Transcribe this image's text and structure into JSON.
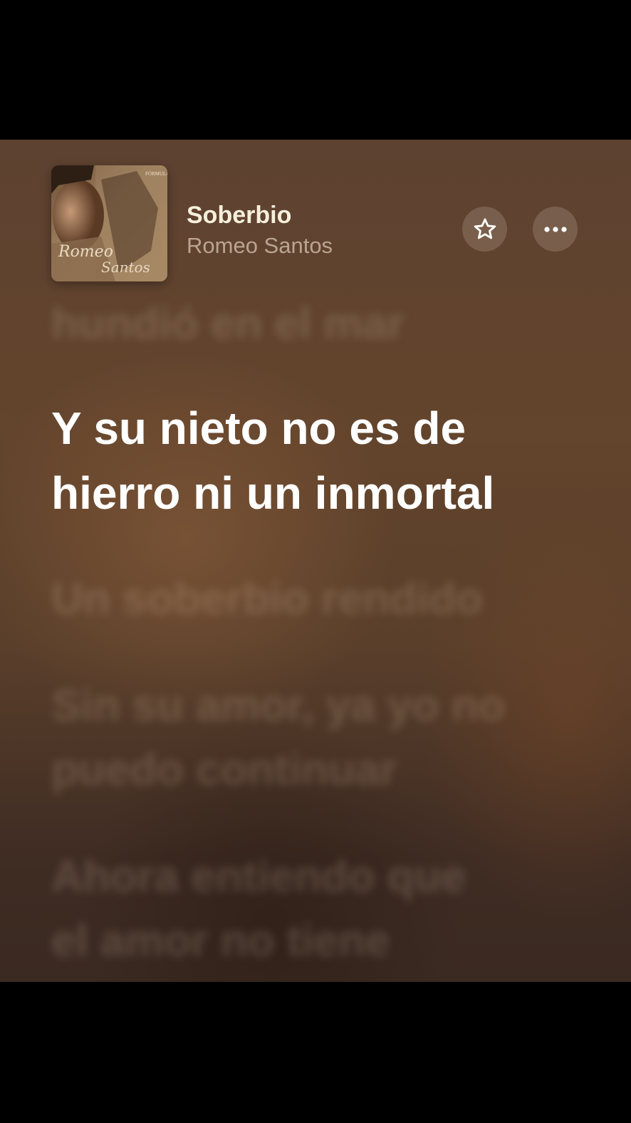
{
  "now_playing": {
    "title": "Soberbio",
    "artist": "Romeo Santos",
    "album_art": {
      "label_top": "FÓRMULA",
      "label_script_1": "Romeo",
      "label_script_2": "Santos"
    }
  },
  "buttons": {
    "favorite_icon": "star-icon",
    "more_icon": "ellipsis-icon"
  },
  "lyrics": {
    "previous_line": "hundió en el mar",
    "current_line_1": "Y su nieto no es de",
    "current_line_2": "hierro ni un inmortal",
    "next_1": "Un soberbio rendido",
    "next_2_line_1": "Sin su amor, ya yo no",
    "next_2_line_2": "puedo continuar",
    "next_3_line_1": "Ahora entiendo que",
    "next_3_line_2": "el amor no tiene"
  },
  "colors": {
    "background": "#5e4231",
    "title": "#f6efdc",
    "active_lyric": "#ffffff"
  }
}
